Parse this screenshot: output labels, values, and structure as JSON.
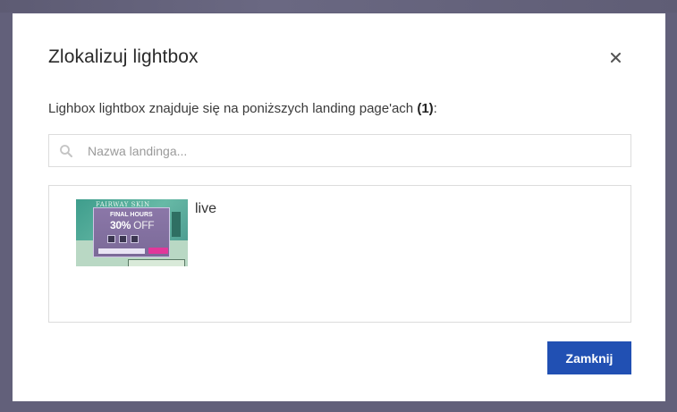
{
  "dialog": {
    "title": "Zlokalizuj lightbox",
    "description_prefix": "Lighbox lightbox znajduje się na poniższych landing page'ach",
    "description_count": "(1)",
    "description_suffix": ":",
    "close_icon": "close-icon"
  },
  "search": {
    "placeholder": "Nazwa landinga...",
    "value": "",
    "icon": "search-icon"
  },
  "landings": [
    {
      "label": "live",
      "thumbnail": {
        "logo": "FAIRWAY SKIN",
        "headline": "FINAL HOURS",
        "discount": "30%",
        "discount_suffix": " OFF",
        "colors": {
          "background": "#4f9e92",
          "popup": "#7b6a98",
          "cta": "#e1379a"
        }
      }
    }
  ],
  "footer": {
    "close_label": "Zamknij",
    "accent": "#2150b3"
  }
}
